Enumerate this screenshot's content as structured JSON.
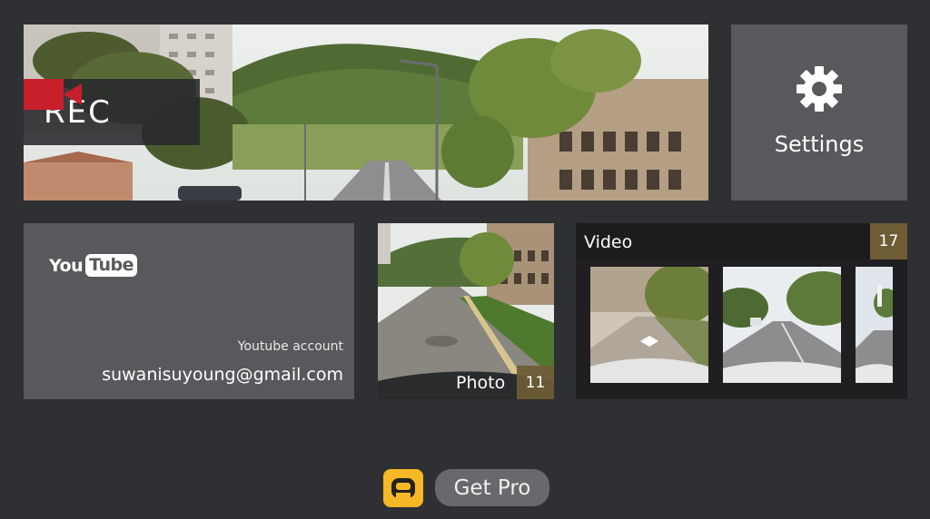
{
  "record": {
    "label": "REC",
    "icon": "video-camera-icon"
  },
  "settings": {
    "label": "Settings",
    "icon": "gear-icon"
  },
  "youtube": {
    "logo_you": "You",
    "logo_tube": "Tube",
    "account_label": "Youtube account",
    "email": "suwanisuyoung@gmail.com"
  },
  "photo": {
    "label": "Photo",
    "count": "11"
  },
  "video": {
    "label": "Video",
    "count": "17"
  },
  "get_pro": {
    "label": "Get Pro",
    "logo_icon": "app-logo-icon"
  },
  "colors": {
    "background": "#2f3033",
    "tile": "#58595c",
    "badge_gold": "#6e5c34",
    "logo_yellow": "#f6b824",
    "rec_red": "#c8202a"
  }
}
